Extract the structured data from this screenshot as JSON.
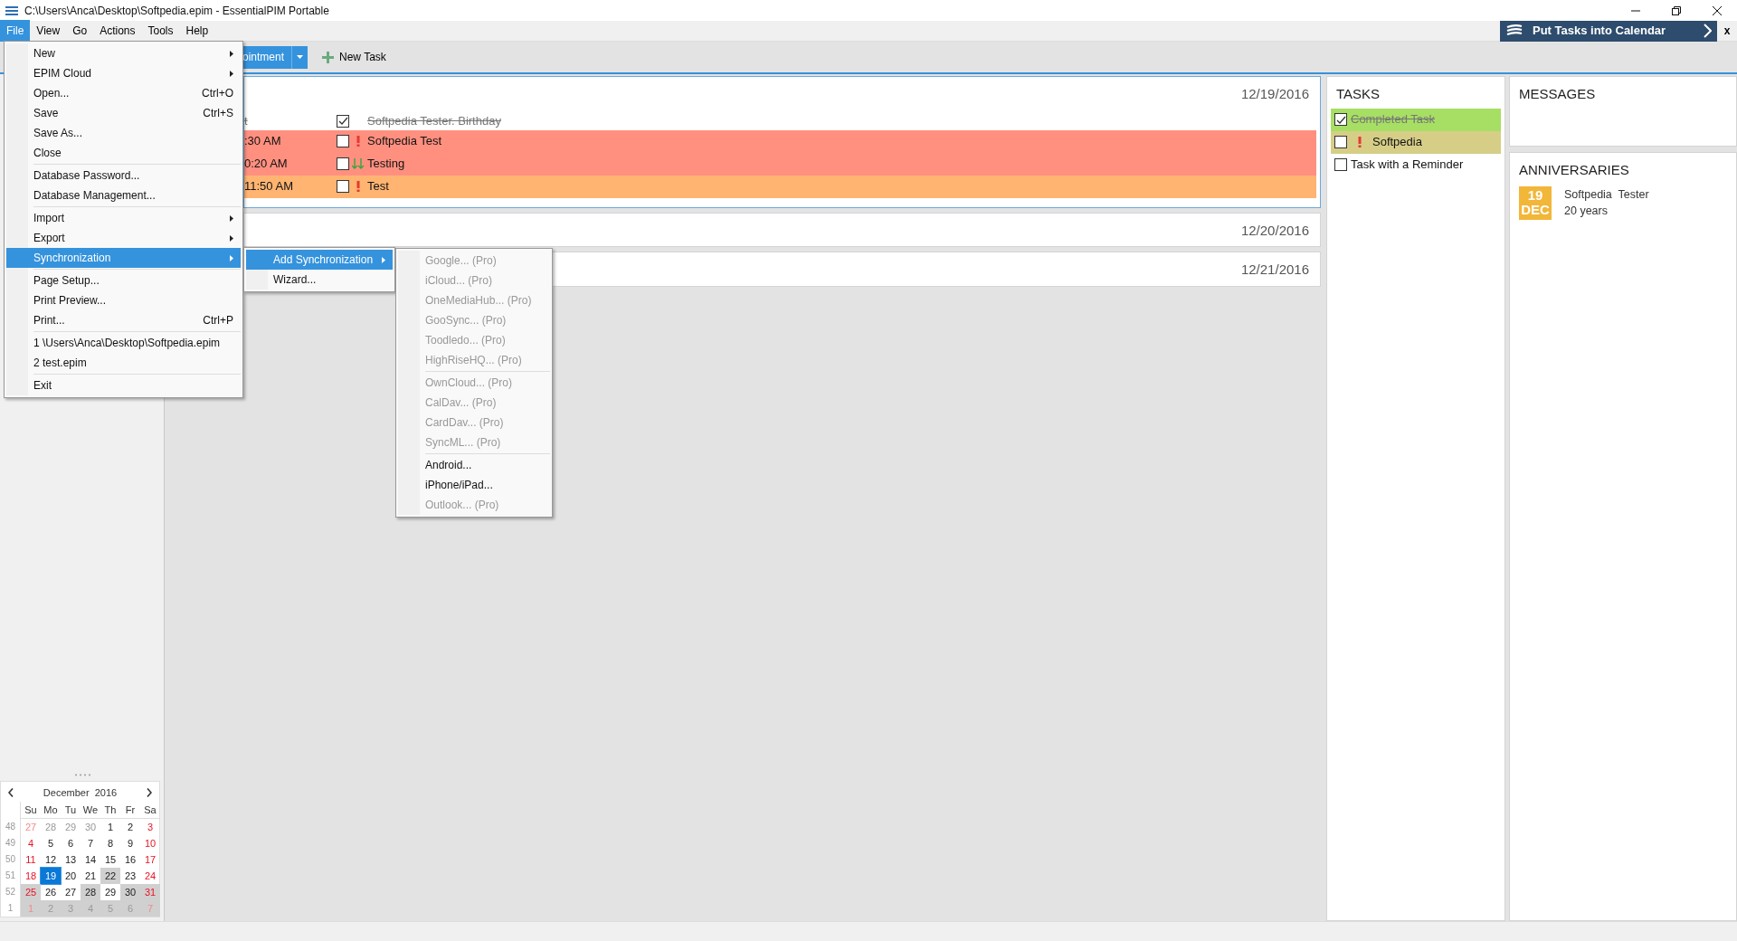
{
  "window": {
    "title": "C:\\Users\\Anca\\Desktop\\Softpedia.epim - EssentialPIM Portable"
  },
  "menu_bar": [
    {
      "label": "File",
      "selected": true
    },
    {
      "label": "View",
      "selected": false
    },
    {
      "label": "Go",
      "selected": false
    },
    {
      "label": "Actions",
      "selected": false
    },
    {
      "label": "Tools",
      "selected": false
    },
    {
      "label": "Help",
      "selected": false
    }
  ],
  "promo": {
    "text": "Put Tasks into Calendar",
    "close": "x"
  },
  "toolbar": {
    "appointment_button": "ointment",
    "new_task": "New Task"
  },
  "file_menu": [
    [
      {
        "label": "New",
        "submenu": true,
        "selected": false
      },
      {
        "label": "EPIM Cloud",
        "submenu": true,
        "selected": false
      },
      {
        "label": "Open...",
        "shortcut": "Ctrl+O",
        "submenu": false,
        "selected": false
      },
      {
        "label": "Save",
        "shortcut": "Ctrl+S",
        "submenu": false,
        "selected": false
      },
      {
        "label": "Save As...",
        "submenu": false,
        "selected": false
      },
      {
        "label": "Close",
        "submenu": false,
        "selected": false
      }
    ],
    [
      {
        "label": "Database Password...",
        "submenu": false,
        "selected": false
      },
      {
        "label": "Database Management...",
        "submenu": false,
        "selected": false
      }
    ],
    [
      {
        "label": "Import",
        "submenu": true,
        "selected": false
      },
      {
        "label": "Export",
        "submenu": true,
        "selected": false
      },
      {
        "label": "Synchronization",
        "submenu": true,
        "selected": true
      }
    ],
    [
      {
        "label": "Page Setup...",
        "submenu": false,
        "selected": false
      },
      {
        "label": "Print Preview...",
        "submenu": false,
        "selected": false
      },
      {
        "label": "Print...",
        "shortcut": "Ctrl+P",
        "submenu": false,
        "selected": false
      }
    ],
    [
      {
        "label": "1 \\Users\\Anca\\Desktop\\Softpedia.epim",
        "submenu": false,
        "selected": false
      },
      {
        "label": "2 test.epim",
        "submenu": false,
        "selected": false
      }
    ],
    [
      {
        "label": "Exit",
        "submenu": false,
        "selected": false
      }
    ]
  ],
  "sync_menu": [
    {
      "label": "Add Synchronization",
      "submenu": true,
      "selected": true
    },
    {
      "label": "Wizard...",
      "submenu": false,
      "selected": false
    }
  ],
  "add_sync_menu": [
    [
      {
        "label": "Google... (Pro)",
        "disabled": true
      },
      {
        "label": "iCloud... (Pro)",
        "disabled": true
      },
      {
        "label": "OneMediaHub... (Pro)",
        "disabled": true
      },
      {
        "label": "GooSync... (Pro)",
        "disabled": true
      },
      {
        "label": "Toodledo... (Pro)",
        "disabled": true
      },
      {
        "label": "HighRiseHQ... (Pro)",
        "disabled": true
      }
    ],
    [
      {
        "label": "OwnCloud... (Pro)",
        "disabled": true
      },
      {
        "label": "CalDav... (Pro)",
        "disabled": true
      },
      {
        "label": "CardDav... (Pro)",
        "disabled": true
      },
      {
        "label": "SyncML... (Pro)",
        "disabled": true
      }
    ],
    [
      {
        "label": "Android...",
        "disabled": false
      },
      {
        "label": "iPhone/iPad...",
        "disabled": false
      },
      {
        "label": "Outlook... (Pro)",
        "disabled": true
      }
    ]
  ],
  "days": [
    {
      "date": "12/19/2016",
      "selected": true,
      "rows": [
        {
          "time": "t",
          "title": "Softpedia Tester. Birthday",
          "checked": true,
          "high_priority": false,
          "low_priority": false
        },
        {
          "time": ":30 AM",
          "title": "Softpedia Test",
          "checked": false,
          "high_priority": true,
          "low_priority": false,
          "color": "#ff9080"
        },
        {
          "time": "0:20 AM",
          "title": "Testing",
          "checked": false,
          "high_priority": false,
          "low_priority": true,
          "color": "#ff9080"
        },
        {
          "time": "11:50 AM",
          "title": "Test",
          "checked": false,
          "high_priority": true,
          "low_priority": false,
          "color": "#ffb472"
        }
      ]
    },
    {
      "date": "12/20/2016",
      "selected": false
    },
    {
      "date": "12/21/2016",
      "selected": false
    }
  ],
  "tasks": {
    "title": "TASKS",
    "items": [
      {
        "label": "Completed Task",
        "checked": true,
        "high_priority": false,
        "color": "#a6df63"
      },
      {
        "label": "Softpedia",
        "checked": false,
        "high_priority": true,
        "color": "#d6ce87"
      },
      {
        "label": "Task with a Reminder",
        "checked": false,
        "high_priority": false
      }
    ]
  },
  "messages": {
    "title": "MESSAGES"
  },
  "anniversaries": {
    "title": "ANNIVERSARIES",
    "items": [
      {
        "day": "19",
        "month": "DEC",
        "name": "Softpedia  Tester",
        "years": "20 years"
      }
    ]
  },
  "mini_calendar": {
    "month": "December  2016",
    "weekdays": [
      "Su",
      "Mo",
      "Tu",
      "We",
      "Th",
      "Fr",
      "Sa"
    ],
    "weeks": [
      {
        "number": "48",
        "days": [
          {
            "d": "27",
            "other": true,
            "shaded": false,
            "selected": false
          },
          {
            "d": "28",
            "other": true,
            "shaded": false,
            "selected": false
          },
          {
            "d": "29",
            "other": true,
            "shaded": false,
            "selected": false
          },
          {
            "d": "30",
            "other": true,
            "shaded": false,
            "selected": false
          },
          {
            "d": "1",
            "other": false,
            "shaded": false,
            "selected": false
          },
          {
            "d": "2",
            "other": false,
            "shaded": false,
            "selected": false
          },
          {
            "d": "3",
            "other": false,
            "shaded": false,
            "selected": false
          }
        ]
      },
      {
        "number": "49",
        "days": [
          {
            "d": "4",
            "other": false,
            "shaded": false,
            "selected": false
          },
          {
            "d": "5",
            "other": false,
            "shaded": false,
            "selected": false
          },
          {
            "d": "6",
            "other": false,
            "shaded": false,
            "selected": false
          },
          {
            "d": "7",
            "other": false,
            "shaded": false,
            "selected": false
          },
          {
            "d": "8",
            "other": false,
            "shaded": false,
            "selected": false
          },
          {
            "d": "9",
            "other": false,
            "shaded": false,
            "selected": false
          },
          {
            "d": "10",
            "other": false,
            "shaded": false,
            "selected": false
          }
        ]
      },
      {
        "number": "50",
        "days": [
          {
            "d": "11",
            "other": false,
            "shaded": false,
            "selected": false
          },
          {
            "d": "12",
            "other": false,
            "shaded": false,
            "selected": false
          },
          {
            "d": "13",
            "other": false,
            "shaded": false,
            "selected": false
          },
          {
            "d": "14",
            "other": false,
            "shaded": false,
            "selected": false
          },
          {
            "d": "15",
            "other": false,
            "shaded": false,
            "selected": false
          },
          {
            "d": "16",
            "other": false,
            "shaded": false,
            "selected": false
          },
          {
            "d": "17",
            "other": false,
            "shaded": false,
            "selected": false
          }
        ]
      },
      {
        "number": "51",
        "days": [
          {
            "d": "18",
            "other": false,
            "shaded": false,
            "selected": false
          },
          {
            "d": "19",
            "other": false,
            "shaded": false,
            "selected": true
          },
          {
            "d": "20",
            "other": false,
            "shaded": false,
            "selected": false
          },
          {
            "d": "21",
            "other": false,
            "shaded": false,
            "selected": false
          },
          {
            "d": "22",
            "other": false,
            "shaded": true,
            "selected": false
          },
          {
            "d": "23",
            "other": false,
            "shaded": false,
            "selected": false
          },
          {
            "d": "24",
            "other": false,
            "shaded": false,
            "selected": false
          }
        ]
      },
      {
        "number": "52",
        "days": [
          {
            "d": "25",
            "other": false,
            "shaded": true,
            "selected": false
          },
          {
            "d": "26",
            "other": false,
            "shaded": false,
            "selected": false
          },
          {
            "d": "27",
            "other": false,
            "shaded": false,
            "selected": false
          },
          {
            "d": "28",
            "other": false,
            "shaded": true,
            "selected": false
          },
          {
            "d": "29",
            "other": false,
            "shaded": false,
            "selected": false
          },
          {
            "d": "30",
            "other": false,
            "shaded": true,
            "selected": false
          },
          {
            "d": "31",
            "other": false,
            "shaded": true,
            "selected": false
          }
        ]
      },
      {
        "number": "1",
        "days": [
          {
            "d": "1",
            "other": true,
            "shaded": true,
            "selected": false
          },
          {
            "d": "2",
            "other": true,
            "shaded": true,
            "selected": false
          },
          {
            "d": "3",
            "other": true,
            "shaded": true,
            "selected": false
          },
          {
            "d": "4",
            "other": true,
            "shaded": true,
            "selected": false
          },
          {
            "d": "5",
            "other": true,
            "shaded": true,
            "selected": false
          },
          {
            "d": "6",
            "other": true,
            "shaded": true,
            "selected": false
          },
          {
            "d": "7",
            "other": true,
            "shaded": true,
            "selected": false
          }
        ]
      }
    ]
  }
}
